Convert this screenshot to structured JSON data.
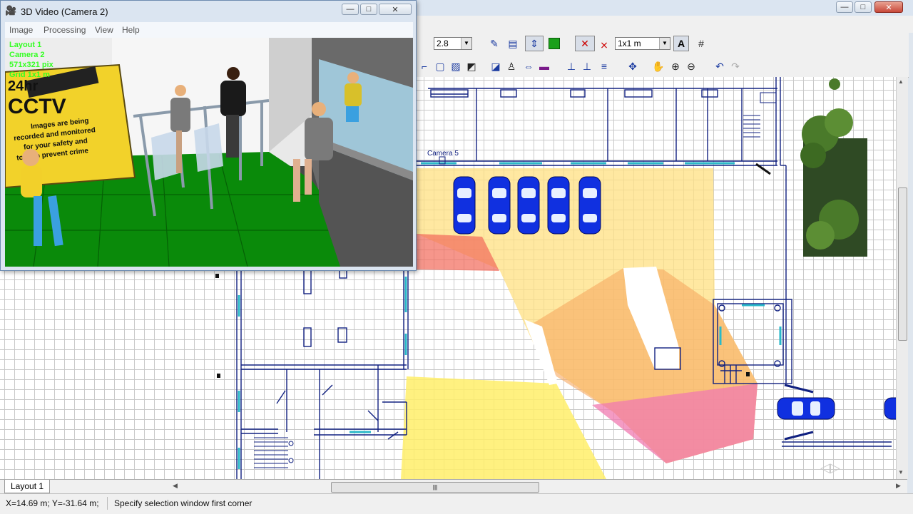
{
  "main_window": {
    "controls": {
      "minimize": "—",
      "maximize": "□",
      "close": "✕"
    }
  },
  "toolbar": {
    "scale_value": "2.8",
    "grid_value": "1x1 m",
    "icons": [
      "pen-color-icon",
      "layers-icon",
      "3d-toggle-icon",
      "green-square-icon",
      "move-icon",
      "pan-hand-icon",
      "zoom-in-icon",
      "zoom-out-icon",
      "undo-icon",
      "redo-icon"
    ]
  },
  "canvas": {
    "camera_label": "Camera 5"
  },
  "video_window": {
    "title": "3D Video (Camera 2)",
    "menu": [
      "Image",
      "Processing",
      "View",
      "Help"
    ],
    "overlay": [
      "Layout 1",
      "Camera 2",
      "571x321 pix",
      "Grid 1x1 m"
    ],
    "scene_sign": {
      "line1": "24hr",
      "line2": "CCTV",
      "line3": "Images are being",
      "line4": "recorded and monitored",
      "line5": "for your safety and",
      "line6": "to help prevent crime"
    }
  },
  "tabs": {
    "active": "Layout 1"
  },
  "status": {
    "coords": "X=14.69 m; Y=-31.64 m;",
    "message": "Specify selection window first corner"
  },
  "colors": {
    "coverage_yellow": "#ffe97a",
    "coverage_orange": "#f7b46a",
    "coverage_pink": "#f06aa8",
    "car_blue": "#1030e0",
    "overlay_green": "#33ff22"
  }
}
